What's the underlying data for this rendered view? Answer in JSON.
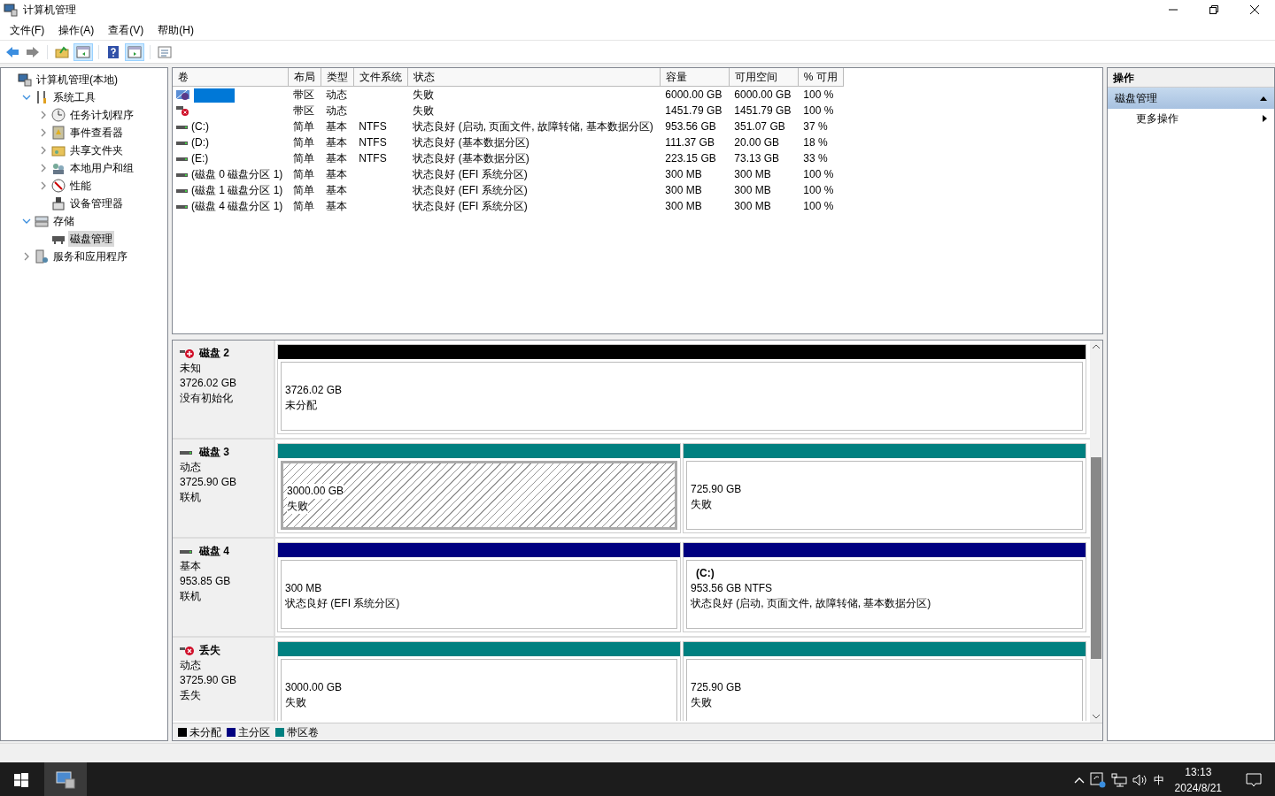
{
  "window": {
    "title": "计算机管理"
  },
  "menu": [
    "文件(F)",
    "操作(A)",
    "查看(V)",
    "帮助(H)"
  ],
  "tree": [
    {
      "label": "计算机管理(本地)",
      "kind": "computer",
      "selected": false,
      "children": [
        {
          "label": "系统工具",
          "kind": "tools",
          "expanded": true,
          "selected": false,
          "children": [
            {
              "label": "任务计划程序",
              "kind": "clock",
              "expanded": false,
              "selected": false
            },
            {
              "label": "事件查看器",
              "kind": "log",
              "expanded": false,
              "selected": false
            },
            {
              "label": "共享文件夹",
              "kind": "folder",
              "expanded": false,
              "selected": false
            },
            {
              "label": "本地用户和组",
              "kind": "users",
              "expanded": false,
              "selected": false
            },
            {
              "label": "性能",
              "kind": "gauge",
              "expanded": false,
              "selected": false
            },
            {
              "label": "设备管理器",
              "kind": "device",
              "selected": false
            }
          ]
        },
        {
          "label": "存储",
          "kind": "storage",
          "expanded": true,
          "selected": false,
          "children": [
            {
              "label": "磁盘管理",
              "kind": "disk",
              "selected": true
            }
          ]
        },
        {
          "label": "服务和应用程序",
          "kind": "services",
          "expanded": false,
          "selected": false
        }
      ]
    }
  ],
  "table": {
    "columns": [
      "卷",
      "布局",
      "类型",
      "文件系统",
      "状态",
      "容量",
      "可用空间",
      "% 可用"
    ],
    "rows": [
      {
        "kind": "striped",
        "selected": true,
        "cells": [
          "",
          "带区",
          "动态",
          "",
          "失败",
          "6000.00 GB",
          "6000.00 GB",
          "100 %"
        ]
      },
      {
        "kind": "failed",
        "selected": false,
        "cells": [
          "",
          "带区",
          "动态",
          "",
          "失败",
          "1451.79 GB",
          "1451.79 GB",
          "100 %"
        ]
      },
      {
        "kind": "simple",
        "selected": false,
        "cells": [
          "(C:)",
          "简单",
          "基本",
          "NTFS",
          "状态良好 (启动, 页面文件, 故障转储, 基本数据分区)",
          "953.56 GB",
          "351.07 GB",
          "37 %"
        ]
      },
      {
        "kind": "simple",
        "selected": false,
        "cells": [
          "(D:)",
          "简单",
          "基本",
          "NTFS",
          "状态良好 (基本数据分区)",
          "111.37 GB",
          "20.00 GB",
          "18 %"
        ]
      },
      {
        "kind": "simple",
        "selected": false,
        "cells": [
          "(E:)",
          "简单",
          "基本",
          "NTFS",
          "状态良好 (基本数据分区)",
          "223.15 GB",
          "73.13 GB",
          "33 %"
        ]
      },
      {
        "kind": "simple",
        "selected": false,
        "cells": [
          "(磁盘 0 磁盘分区 1)",
          "简单",
          "基本",
          "",
          "状态良好 (EFI 系统分区)",
          "300 MB",
          "300 MB",
          "100 %"
        ]
      },
      {
        "kind": "simple",
        "selected": false,
        "cells": [
          "(磁盘 1 磁盘分区 1)",
          "简单",
          "基本",
          "",
          "状态良好 (EFI 系统分区)",
          "300 MB",
          "300 MB",
          "100 %"
        ]
      },
      {
        "kind": "simple",
        "selected": false,
        "cells": [
          "(磁盘 4 磁盘分区 1)",
          "简单",
          "基本",
          "",
          "状态良好 (EFI 系统分区)",
          "300 MB",
          "300 MB",
          "100 %"
        ]
      }
    ]
  },
  "disks": [
    {
      "name": "磁盘 2",
      "kind": "error",
      "type": "未知",
      "size": "3726.02 GB",
      "state": "没有初始化",
      "partitions": [
        {
          "kind": "unallocated",
          "selected": false,
          "size": "3726.02 GB",
          "status": "未分配"
        }
      ]
    },
    {
      "name": "磁盘 3",
      "kind": "online",
      "type": "动态",
      "size": "3725.90 GB",
      "state": "联机",
      "partitions": [
        {
          "kind": "striped",
          "selected": true,
          "size": "3000.00 GB",
          "status": "失败"
        },
        {
          "kind": "striped",
          "selected": false,
          "size": "725.90 GB",
          "status": "失败"
        }
      ]
    },
    {
      "name": "磁盘 4",
      "kind": "online",
      "type": "基本",
      "size": "953.85 GB",
      "state": "联机",
      "partitions": [
        {
          "kind": "primary",
          "selected": false,
          "size": "300 MB",
          "status": "状态良好 (EFI 系统分区)"
        },
        {
          "kind": "primary",
          "selected": false,
          "label": "(C:)",
          "size": "953.56 GB NTFS",
          "status": "状态良好 (启动, 页面文件, 故障转储, 基本数据分区)"
        }
      ]
    },
    {
      "name": "丢失",
      "kind": "missing",
      "type": "动态",
      "size": "3725.90 GB",
      "state": "丢失",
      "partitions": [
        {
          "kind": "striped",
          "selected": false,
          "size": "3000.00 GB",
          "status": "失败"
        },
        {
          "kind": "striped",
          "selected": false,
          "size": "725.90 GB",
          "status": "失败"
        }
      ]
    }
  ],
  "legend": [
    {
      "kind": "unallocated",
      "label": "未分配",
      "color": "#000000"
    },
    {
      "kind": "primary",
      "label": "主分区",
      "color": "#000080"
    },
    {
      "kind": "striped",
      "label": "带区卷",
      "color": "#008080"
    }
  ],
  "actions": {
    "title": "操作",
    "section": {
      "label": "磁盘管理",
      "expanded": true
    },
    "items": [
      "更多操作"
    ]
  },
  "taskbar": {
    "app_active": true,
    "ime": "中",
    "time": "13:13",
    "date": "2024/8/21"
  }
}
